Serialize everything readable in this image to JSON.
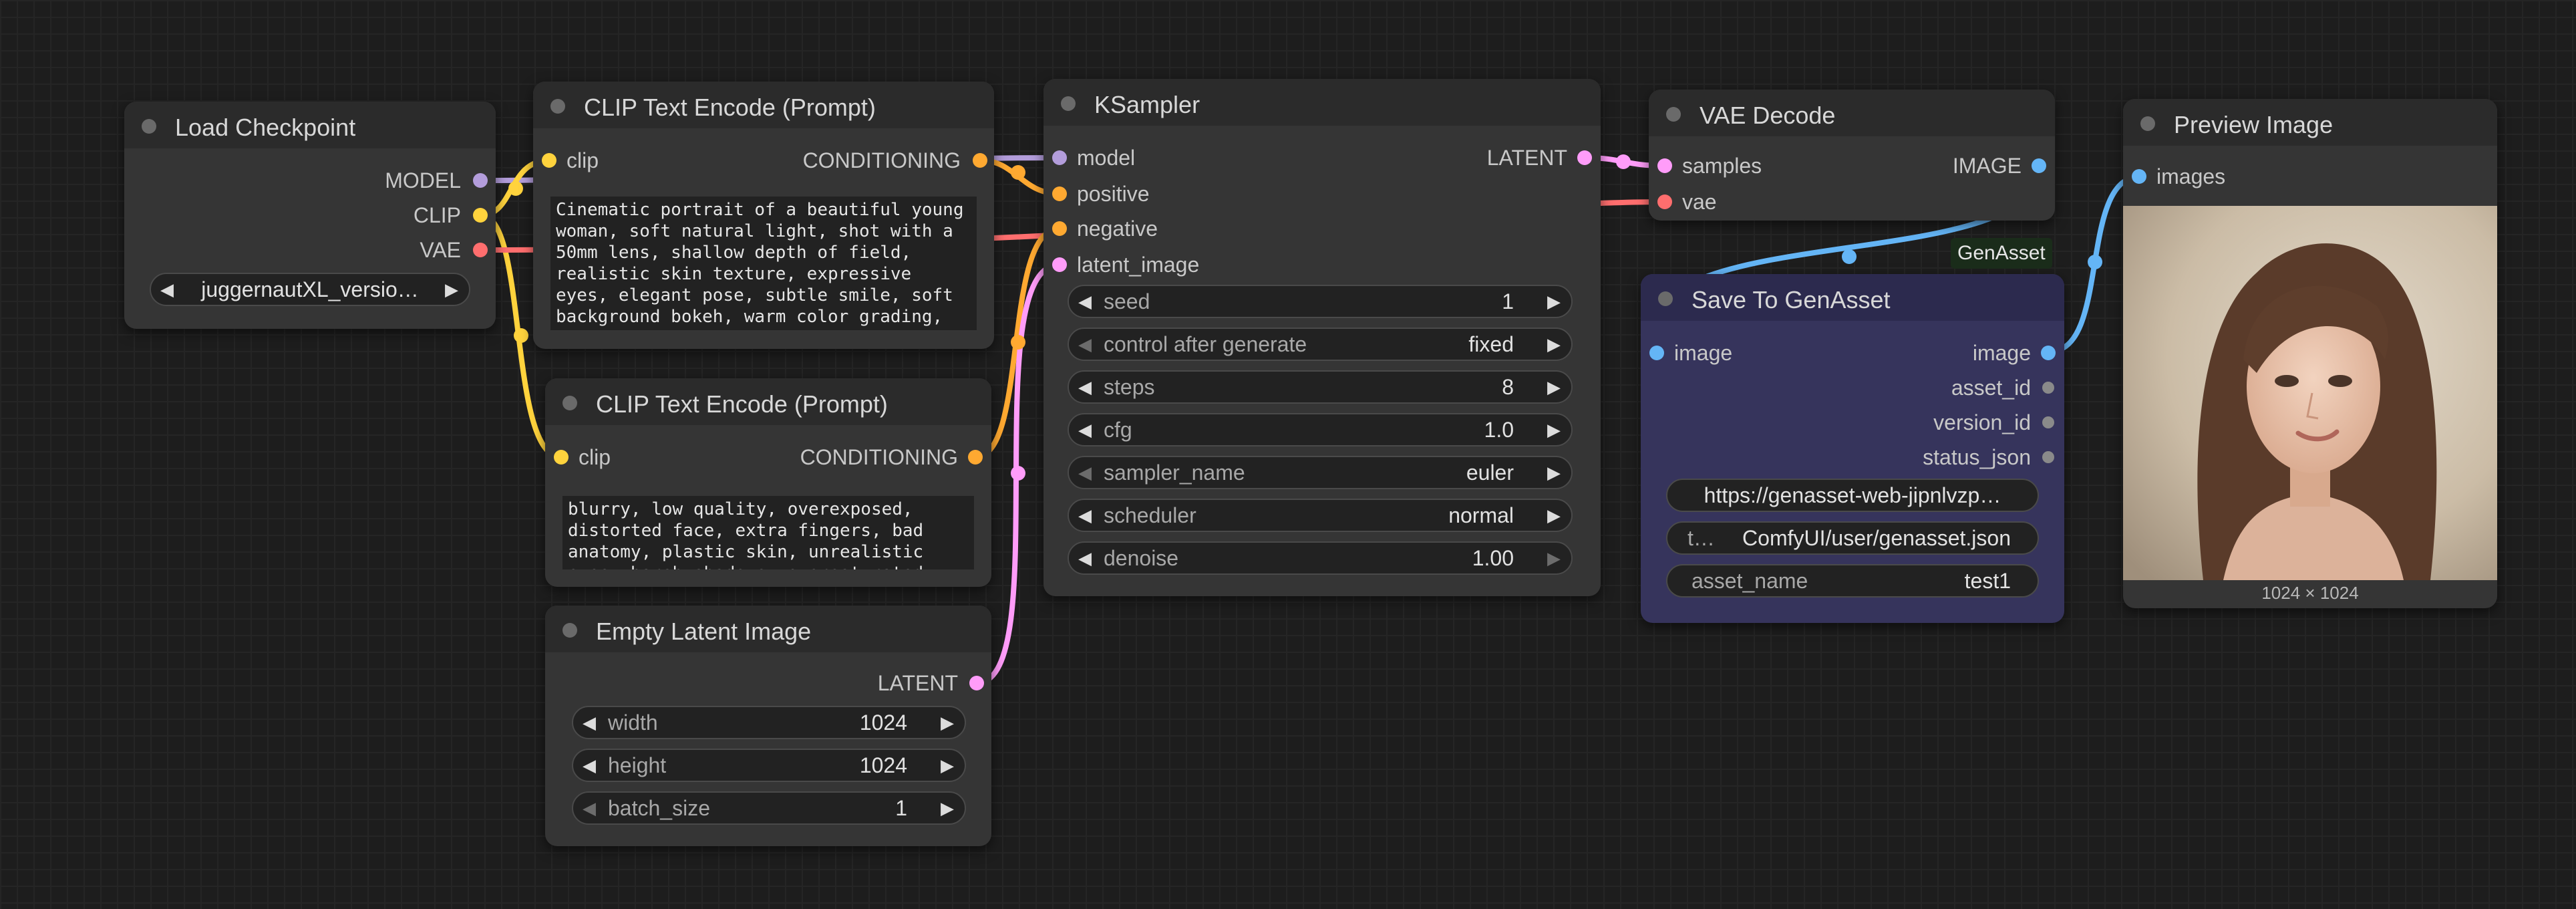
{
  "colors": {
    "model": "#b39ddb",
    "clip": "#ffd33d",
    "vae": "#ff6e6e",
    "conditioning": "#ffa931",
    "latent": "#ff9cf9",
    "image": "#64b5f6",
    "genasset_node_bg": "#36345c",
    "genasset_header_bg": "#2c2a4e"
  },
  "nodes": {
    "load_checkpoint": {
      "title": "Load Checkpoint",
      "outputs": [
        "MODEL",
        "CLIP",
        "VAE"
      ],
      "ckpt_name": "juggernautXL_versio…"
    },
    "clip_pos": {
      "title": "CLIP Text Encode (Prompt)",
      "input": "clip",
      "output": "CONDITIONING",
      "text": "Cinematic portrait of a beautiful young woman, soft natural light, shot with a 50mm lens, shallow depth of field, realistic skin texture, expressive eyes, elegant pose, subtle smile, soft background bokeh, warm color grading,"
    },
    "clip_neg": {
      "title": "CLIP Text Encode (Prompt)",
      "input": "clip",
      "output": "CONDITIONING",
      "text": "blurry, low quality, overexposed, distorted face, extra fingers, bad anatomy, plastic skin, unrealistic eyes, harsh shadows, oversaturated"
    },
    "empty_latent": {
      "title": "Empty Latent Image",
      "output": "LATENT",
      "widgets": [
        {
          "label": "width",
          "value": "1024"
        },
        {
          "label": "height",
          "value": "1024"
        },
        {
          "label": "batch_size",
          "value": "1"
        }
      ]
    },
    "ksampler": {
      "title": "KSampler",
      "inputs": [
        "model",
        "positive",
        "negative",
        "latent_image"
      ],
      "output": "LATENT",
      "widgets": [
        {
          "label": "seed",
          "value": "1"
        },
        {
          "label": "control after generate",
          "value": "fixed"
        },
        {
          "label": "steps",
          "value": "8"
        },
        {
          "label": "cfg",
          "value": "1.0"
        },
        {
          "label": "sampler_name",
          "value": "euler"
        },
        {
          "label": "scheduler",
          "value": "normal"
        },
        {
          "label": "denoise",
          "value": "1.00"
        }
      ]
    },
    "vae_decode": {
      "title": "VAE Decode",
      "inputs": [
        "samples",
        "vae"
      ],
      "output": "IMAGE"
    },
    "save_genasset": {
      "title": "Save To GenAsset",
      "badge": "GenAsset",
      "input": "image",
      "outputs": [
        "image",
        "asset_id",
        "version_id",
        "status_json"
      ],
      "url": "https://genasset-web-jipnlvzp…",
      "token_label": "t…",
      "token_value": "ComfyUI/user/genasset.json",
      "asset_name_label": "asset_name",
      "asset_name_value": "test1"
    },
    "preview_image": {
      "title": "Preview Image",
      "input": "images",
      "caption": "1024 × 1024"
    }
  }
}
